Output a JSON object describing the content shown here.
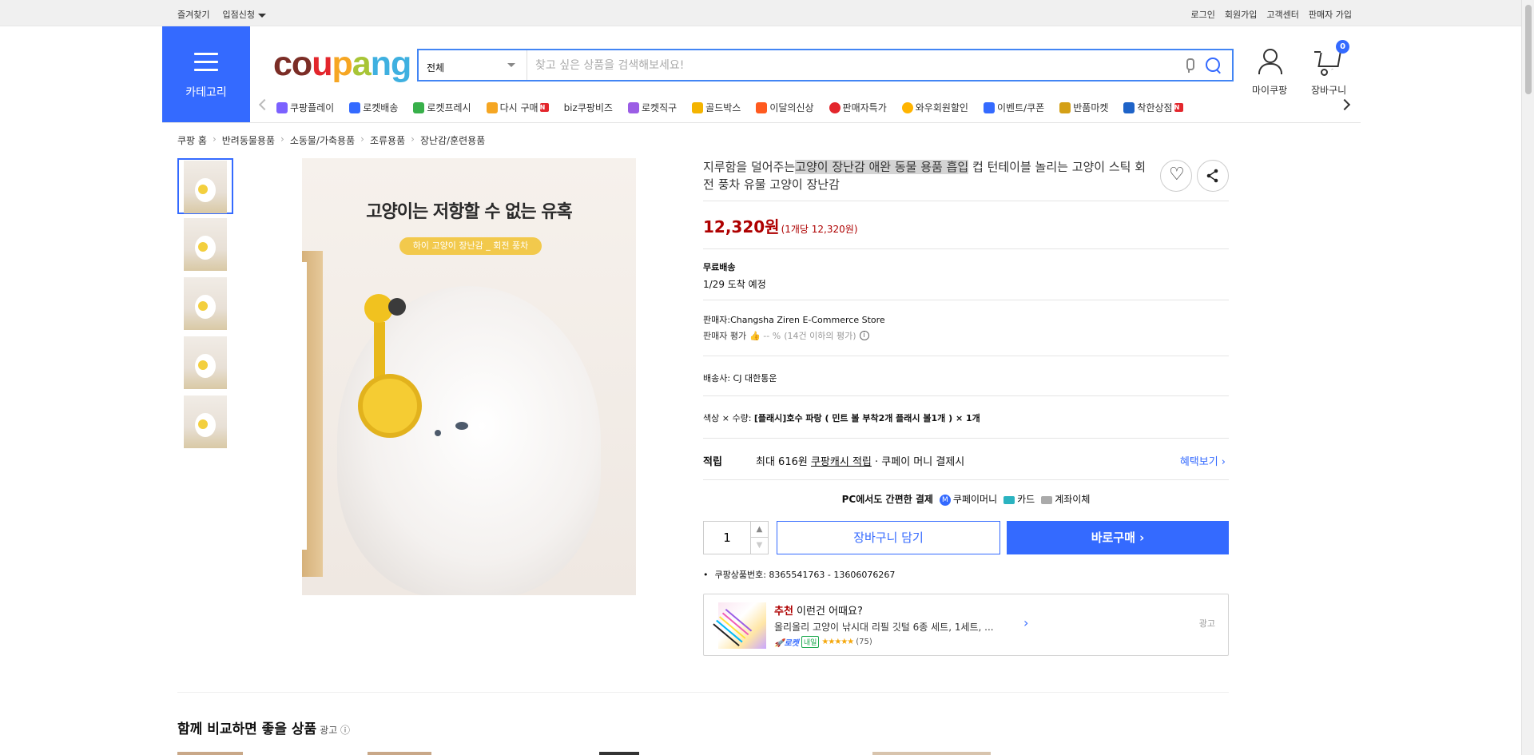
{
  "topbar": {
    "left": [
      "즐겨찾기",
      "입점신청"
    ],
    "right": [
      "로그인",
      "회원가입",
      "고객센터",
      "판매자 가입"
    ]
  },
  "header": {
    "category_label": "카테고리",
    "logo_letters": [
      "c",
      "o",
      "u",
      "p",
      "a",
      "n",
      "g"
    ],
    "search_category": "전체",
    "search_placeholder": "찾고 싶은 상품을 검색해보세요!",
    "mypage_label": "마이쿠팡",
    "cart_label": "장바구니",
    "cart_count": "0"
  },
  "nav": {
    "items": [
      {
        "label": "쿠팡플레이",
        "color": "#7b61ff"
      },
      {
        "label": "로켓배송",
        "color": "#346aff"
      },
      {
        "label": "로켓프레시",
        "color": "#38b04a"
      },
      {
        "label": "다시 구매",
        "color": "#f5a623",
        "new": "N"
      },
      {
        "label": "biz쿠팡비즈",
        "color": "#ffffff"
      },
      {
        "label": "로켓직구",
        "color": "#9b5de5"
      },
      {
        "label": "골드박스",
        "color": "#f4b400"
      },
      {
        "label": "이달의신상",
        "color": "#ff5a1f"
      },
      {
        "label": "판매자특가",
        "color": "#e3262c"
      },
      {
        "label": "와우회원할인",
        "color": "#ffb400"
      },
      {
        "label": "이벤트/쿠폰",
        "color": "#346aff"
      },
      {
        "label": "반품마켓",
        "color": "#d4a017"
      },
      {
        "label": "착한상점",
        "color": "#1e63c8",
        "new": "N"
      }
    ]
  },
  "breadcrumb": [
    "쿠팡 홈",
    "반려동물용품",
    "소동물/가축용품",
    "조류용품",
    "장난감/훈련용품"
  ],
  "gallery": {
    "headline": "고양이는 저항할 수 없는 유혹",
    "pill": "하이 고양이 장난감 _ 회전 풍차"
  },
  "product": {
    "title_pre": "지루함을 덜어주는",
    "title_highlight": "고양이 장난감 애완 동물 용품 흡입",
    "title_post": "컵 턴테이블 놀리는 고양이 스틱 회전 풍차 유물 고양이 장난감",
    "price": "12,320원",
    "unit_price": "(1개당 12,320원)",
    "shipping_type": "무료배송",
    "arrival": "1/29 도착 예정",
    "seller": "판매자:Changsha Ziren E-Commerce Store",
    "seller_rating_label": "판매자 평가",
    "seller_rating_value": "👍 -- %",
    "seller_rating_note": "(14건 이하의 평가)",
    "courier": "배송사:  CJ 대한통운",
    "option_label": "색상 × 수량: ",
    "option_value": "[플래시]호수 파랑 ( 민트 볼 부착2개 플래시 볼1개 )  × 1개",
    "point_key": "적립",
    "point_text1": "최대 616원 ",
    "point_link": "쿠팡캐시 적립",
    "point_text2": " · 쿠페이 머니 결제시",
    "point_more": "혜택보기 ›",
    "pay_title": "PC에서도 간편한 결제",
    "pay_money": "쿠페이머니",
    "pay_card": "카드",
    "pay_bank": "계좌이체",
    "quantity": "1",
    "add_cart": "장바구니 담기",
    "buy_now": "바로구매 ›",
    "product_id": "쿠팡상품번호: 8365541763 - 13606076267"
  },
  "recommend": {
    "prefix": "추천",
    "title": " 이런건 어때요?",
    "name": "올리올리 고양이 낚시대 리필 깃털 6종 세트, 1세트, ...",
    "rocket": "🚀로켓",
    "tomorrow": "내일",
    "stars": "★★★★★",
    "reviews": "(75)",
    "ad": "광고"
  },
  "compare": {
    "title": "함께 비교하면 좋을 상품",
    "ad": "광고 ⓘ"
  }
}
